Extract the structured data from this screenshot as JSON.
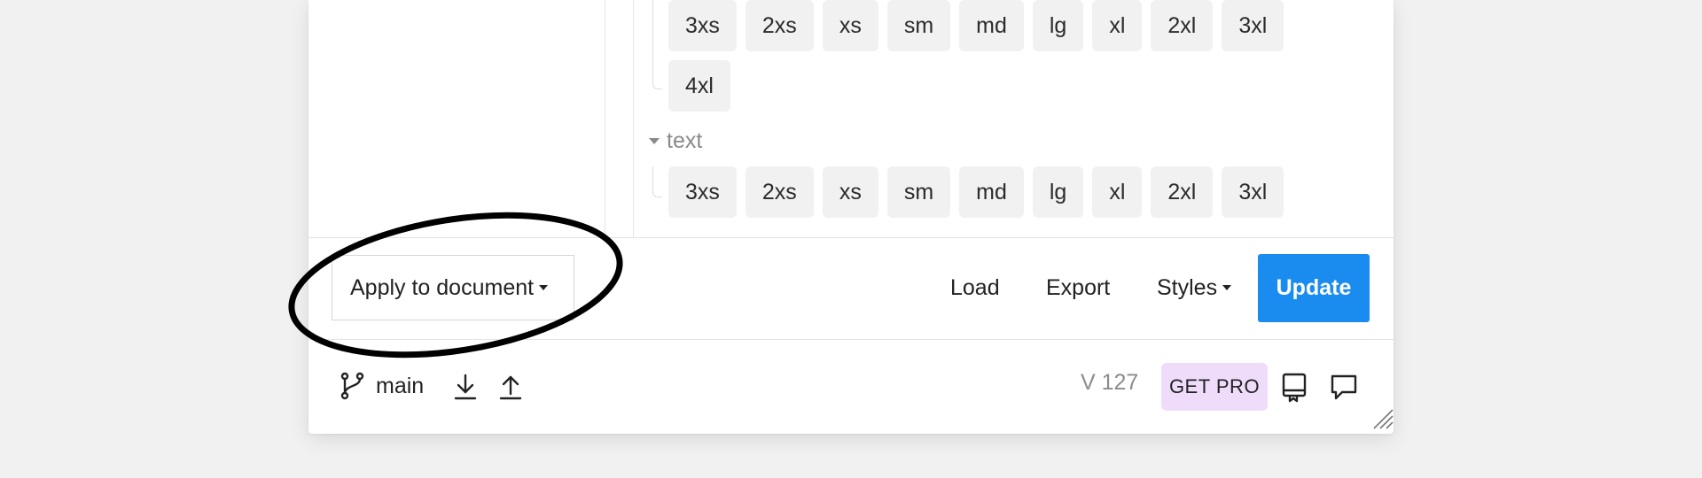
{
  "chips": {
    "first_group": [
      "3xs",
      "2xs",
      "xs",
      "sm",
      "md",
      "lg",
      "xl",
      "2xl",
      "3xl",
      "4xl"
    ],
    "second_group": [
      "3xs",
      "2xs",
      "xs",
      "sm",
      "md",
      "lg",
      "xl",
      "2xl",
      "3xl"
    ]
  },
  "text_group": {
    "title": "text"
  },
  "toolbar": {
    "apply_label": "Apply to document",
    "load_label": "Load",
    "export_label": "Export",
    "styles_label": "Styles",
    "update_label": "Update"
  },
  "footer": {
    "branch": "main",
    "version": "V 127",
    "pro_label": "GET PRO"
  },
  "colors": {
    "accent": "#1a8cf0",
    "pro_badge_bg": "#efdcfb",
    "chip_bg": "#f1f1f1"
  },
  "icons": [
    "branch-icon",
    "download-icon",
    "upload-icon",
    "library-icon",
    "comment-icon",
    "resize-grip-icon"
  ]
}
